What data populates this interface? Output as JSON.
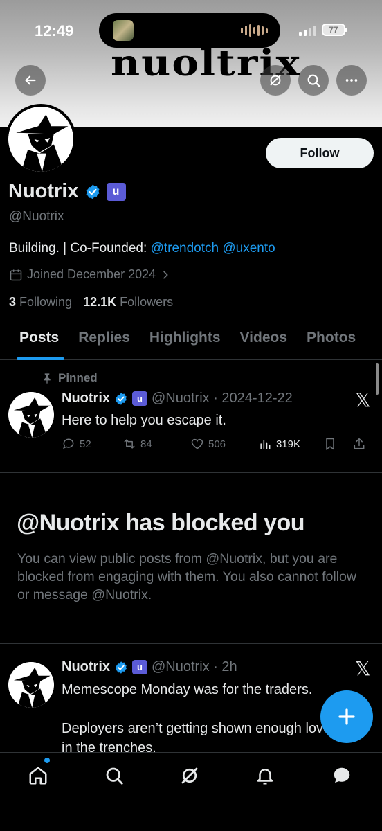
{
  "status_bar": {
    "time": "12:49",
    "battery": "77"
  },
  "banner": {
    "brand_text": "nuoltrix"
  },
  "header_actions": {
    "back": "back-arrow",
    "grok": "grok-icon",
    "search": "search-icon",
    "more": "more-icon"
  },
  "profile": {
    "name": "Nuotrix",
    "badge_letter": "u",
    "handle": "@Nuotrix",
    "bio_text": "Building. | Co-Founded: ",
    "bio_link_1": "@trendotch",
    "bio_link_2": "@uxento",
    "joined": "Joined December 2024",
    "following_count": "3",
    "following_label": "Following",
    "followers_count": "12.1K",
    "followers_label": "Followers",
    "follow_button": "Follow"
  },
  "tabs": [
    "Posts",
    "Replies",
    "Highlights",
    "Videos",
    "Photos"
  ],
  "pinned_post": {
    "pinned_label": "Pinned",
    "author": "Nuotrix",
    "badge_letter": "u",
    "meta": "@Nuotrix · 2024-12-22",
    "text": "Here to help you escape it.",
    "replies": "52",
    "reposts": "84",
    "likes": "506",
    "views": "319K"
  },
  "blocked": {
    "title": "@Nuotrix has blocked you",
    "body": "You can view public posts from @Nuotrix, but you are blocked from engaging with them. You also cannot follow or message @Nuotrix."
  },
  "second_post": {
    "author": "Nuotrix",
    "badge_letter": "u",
    "meta": "@Nuotrix · 2h",
    "line1": "Memescope Monday was for the traders.",
    "line2": "Deployers aren’t getting shown enough love",
    "line3": "in the trenches."
  },
  "colors": {
    "accent": "#1d9bf0",
    "badge": "#5b5bd6",
    "muted": "#71767b",
    "background": "#000000"
  },
  "bottom_nav": [
    "home-icon",
    "search-icon",
    "grok-icon",
    "notifications-icon",
    "messages-icon"
  ]
}
